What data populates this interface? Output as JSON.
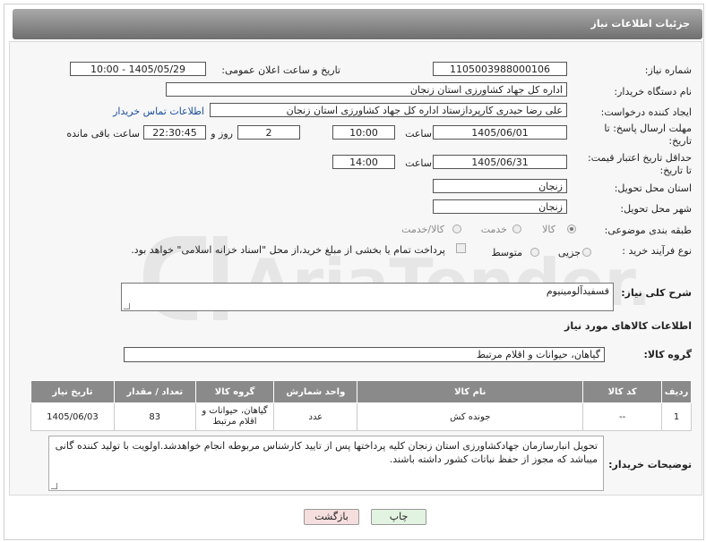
{
  "header": {
    "title": "جزئیات اطلاعات نیاز"
  },
  "fields": {
    "need_number_label": "شماره نیاز:",
    "need_number": "1105003988000106",
    "announce_label": "تاریخ و ساعت اعلان عمومی:",
    "announce_value": "1405/05/29 - 10:00",
    "buyer_org_label": "نام دستگاه خریدار:",
    "buyer_org": "اداره کل جهاد کشاورزی استان زنجان",
    "creator_label": "ایجاد کننده درخواست:",
    "creator": "علی رضا حیدری کارپرداز‌ستاد اداره کل جهاد کشاورزی استان زنجان",
    "contact_link": "اطلاعات تماس خریدار",
    "reply_deadline_label_1": "مهلت ارسال پاسخ: تا",
    "reply_deadline_label_2": "تاریخ:",
    "reply_date": "1405/06/01",
    "time_label": "ساعت",
    "reply_time": "10:00",
    "days_value": "2",
    "days_label": "روز و",
    "remaining_time": "22:30:45",
    "remaining_label": "ساعت باقی مانده",
    "price_validity_label_1": "حداقل تاریخ اعتبار قیمت:",
    "price_validity_label_2": "تا تاریخ:",
    "price_date": "1405/06/31",
    "price_time": "14:00",
    "province_label": "استان محل تحویل:",
    "province": "زنجان",
    "city_label": "شهر محل تحویل:",
    "city": "زنجان",
    "category_label": "طبقه بندی موضوعی:",
    "category_options": [
      "کالا",
      "خدمت",
      "کالا/خدمت"
    ],
    "process_label": "نوع فرآیند خرید :",
    "process_options": [
      "جزیی",
      "متوسط"
    ],
    "payment_note": "پرداخت تمام یا بخشی از مبلغ خرید،از محل \"اسناد خزانه اسلامی\" خواهد بود.",
    "description_label": "شرح کلی نیاز:",
    "description": "فسفیدآلومینیوم",
    "goods_info_title": "اطلاعات کالاهای مورد نیاز",
    "goods_group_label": "گروه کالا:",
    "goods_group": "گیاهان، حیوانات و اقلام مرتبط"
  },
  "table": {
    "headers": [
      "ردیف",
      "کد کالا",
      "نام کالا",
      "واحد شمارش",
      "گروه کالا",
      "تعداد / مقدار",
      "تاریخ نیاز"
    ],
    "rows": [
      [
        "1",
        "--",
        "جونده کش",
        "عدد",
        "گیاهان، حیوانات و اقلام مرتبط",
        "83",
        "1405/06/03"
      ]
    ]
  },
  "buyer_notes_label": "توضیحات خریدار:",
  "buyer_notes": "تحویل انبارسازمان جهادکشاورزی استان زنجان کلیه پرداختها پس از تایید کارشناس مربوطه انجام خواهدشد.اولویت با تولید کننده گانی میباشد که مجوز از حفظ نباتات کشور داشته باشند.",
  "buttons": {
    "print": "چاپ",
    "back": "بازگشت"
  },
  "watermark_text": "AriaTender.neT",
  "colors": {
    "header": "#8a8a8a",
    "link": "#1a4f9c",
    "back_button": "#f7d9d9",
    "print_button": "#dff3df"
  }
}
